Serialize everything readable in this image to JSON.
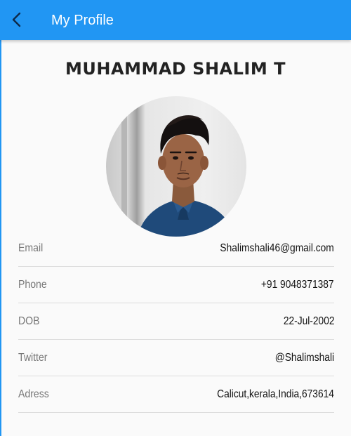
{
  "appbar": {
    "title": "My Profile",
    "background_color": "#2196f3",
    "back_icon": "chevron-left-icon"
  },
  "profile": {
    "name": "MUHAMMAD SHALIM T",
    "avatar": "profile-photo"
  },
  "details": [
    {
      "label": "Email",
      "value": "Shalimshali46@gmail.com"
    },
    {
      "label": "Phone",
      "value": "+91 9048371387"
    },
    {
      "label": "DOB",
      "value": "22-Jul-2002"
    },
    {
      "label": "Twitter",
      "value": "@Shalimshali"
    },
    {
      "label": "Adress",
      "value": "Calicut,kerala,India,673614"
    }
  ]
}
